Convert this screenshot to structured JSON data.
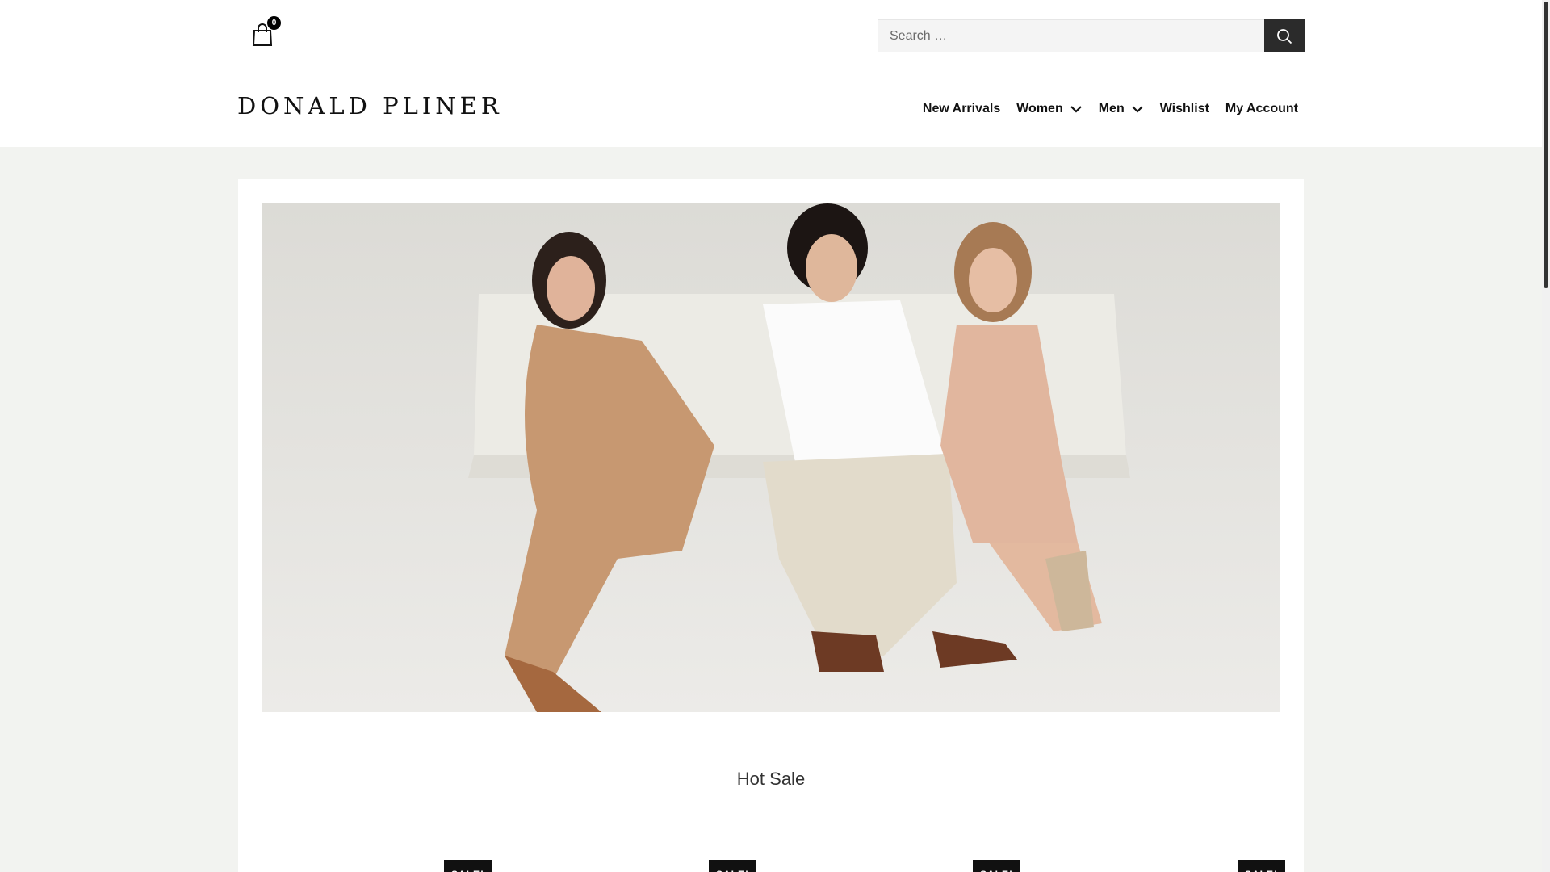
{
  "header": {
    "cart_count": "0",
    "search": {
      "placeholder": "Search …"
    },
    "logo": "DONALD PLINER",
    "nav": [
      {
        "label": "New Arrivals",
        "dropdown": false
      },
      {
        "label": "Women",
        "dropdown": true
      },
      {
        "label": "Men",
        "dropdown": true
      },
      {
        "label": "Wishlist",
        "dropdown": false
      },
      {
        "label": "My Account",
        "dropdown": false
      }
    ]
  },
  "main": {
    "section_title": "Hot Sale",
    "product_badges": [
      "SALE!",
      "SALE!",
      "SALE!",
      "SALE!"
    ]
  },
  "colors": {
    "accent": "#2b2b2b",
    "page_bg": "#f2f3f0",
    "badge": "#111111"
  },
  "icons": {
    "cart": "shopping-bag-icon",
    "search": "search-icon",
    "dropdown": "chevron-down-icon"
  }
}
